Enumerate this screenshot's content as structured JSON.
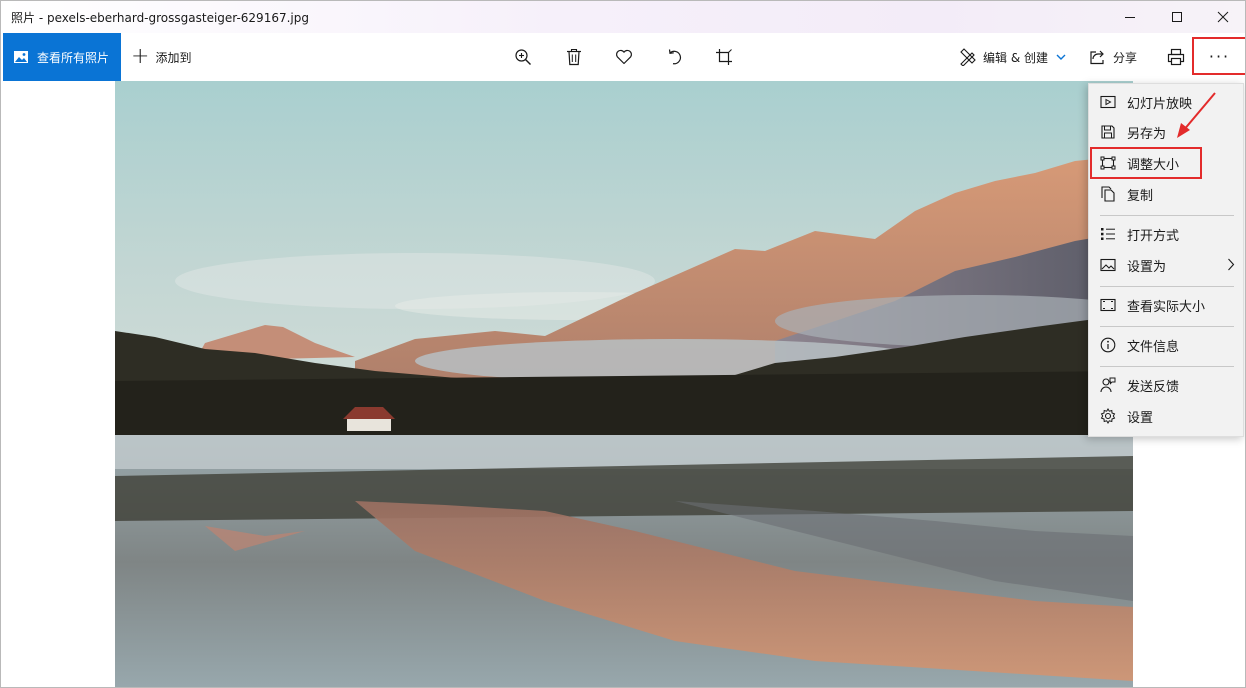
{
  "window": {
    "title": "照片 - pexels-eberhard-grossgasteiger-629167.jpg"
  },
  "toolbar": {
    "view_all_label": "查看所有照片",
    "add_to_label": "添加到",
    "edit_create_label": "编辑 & 创建",
    "share_label": "分享",
    "more_label": "···"
  },
  "menu": {
    "items": [
      {
        "label": "幻灯片放映",
        "icon": "slideshow-icon"
      },
      {
        "label": "另存为",
        "icon": "save-icon"
      },
      {
        "label": "调整大小",
        "icon": "resize-icon"
      },
      {
        "label": "复制",
        "icon": "copy-icon"
      },
      {
        "label": "打开方式",
        "icon": "open-with-icon"
      },
      {
        "label": "设置为",
        "icon": "set-as-icon"
      },
      {
        "label": "查看实际大小",
        "icon": "actual-size-icon"
      },
      {
        "label": "文件信息",
        "icon": "info-icon"
      },
      {
        "label": "发送反馈",
        "icon": "feedback-icon"
      },
      {
        "label": "设置",
        "icon": "settings-icon"
      }
    ]
  },
  "colors": {
    "accent": "#0a74d5",
    "annotation_red": "#e32b2b",
    "menu_bg": "#f2f2f2"
  }
}
